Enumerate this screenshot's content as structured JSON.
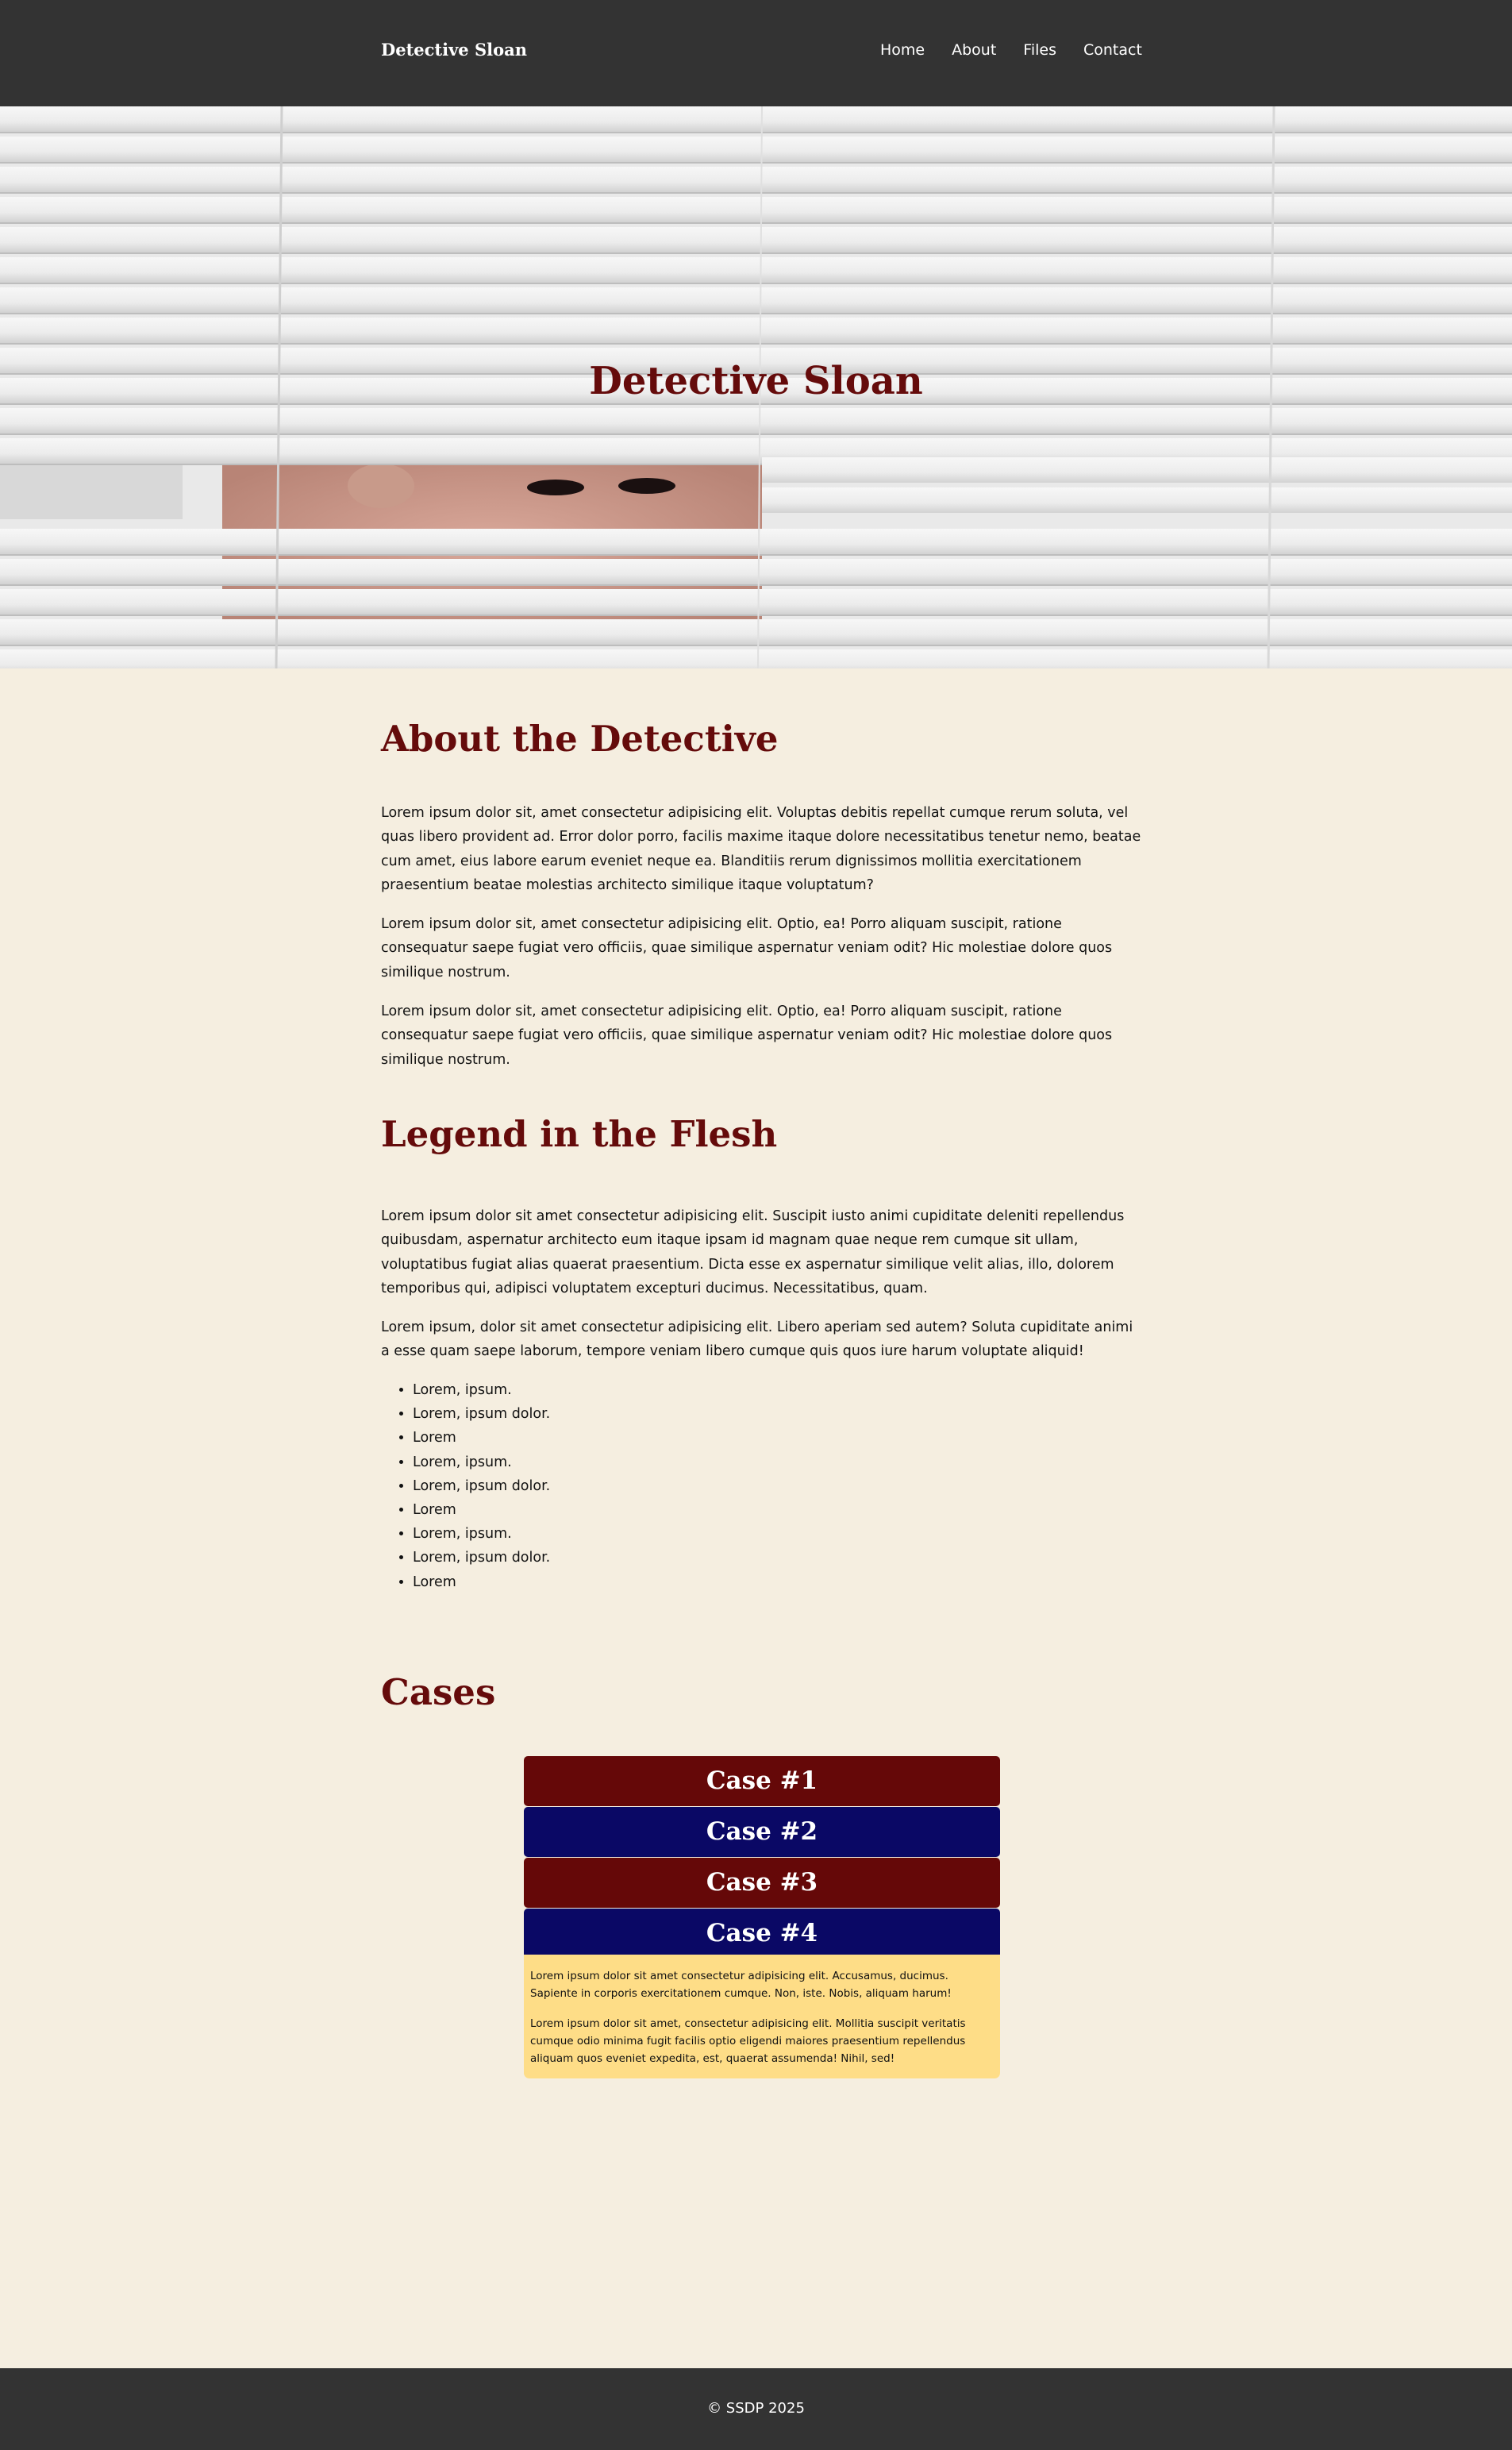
{
  "header": {
    "brand": "Detective Sloan",
    "nav": [
      "Home",
      "About",
      "Files",
      "Contact"
    ]
  },
  "hero": {
    "title": "Detective Sloan",
    "image_alt": "person-peeking-through-window-blinds"
  },
  "about": {
    "heading": "About the Detective",
    "paragraphs": [
      "Lorem ipsum dolor sit, amet consectetur adipisicing elit. Voluptas debitis repellat cumque rerum soluta, vel quas libero provident ad. Error dolor porro, facilis maxime itaque dolore necessitatibus tenetur nemo, beatae cum amet, eius labore earum eveniet neque ea. Blanditiis rerum dignissimos mollitia exercitationem praesentium beatae molestias architecto similique itaque voluptatum?",
      "Lorem ipsum dolor sit, amet consectetur adipisicing elit. Optio, ea! Porro aliquam suscipit, ratione consequatur saepe fugiat vero officiis, quae similique aspernatur veniam odit? Hic molestiae dolore quos similique nostrum.",
      "Lorem ipsum dolor sit, amet consectetur adipisicing elit. Optio, ea! Porro aliquam suscipit, ratione consequatur saepe fugiat vero officiis, quae similique aspernatur veniam odit? Hic molestiae dolore quos similique nostrum."
    ]
  },
  "legend": {
    "heading": "Legend in the Flesh",
    "paragraphs": [
      "Lorem ipsum dolor sit amet consectetur adipisicing elit. Suscipit iusto animi cupiditate deleniti repellendus quibusdam, aspernatur architecto eum itaque ipsam id magnam quae neque rem cumque sit ullam, voluptatibus fugiat alias quaerat praesentium. Dicta esse ex aspernatur similique velit alias, illo, dolorem temporibus qui, adipisci voluptatem excepturi ducimus. Necessitatibus, quam.",
      "Lorem ipsum, dolor sit amet consectetur adipisicing elit. Libero aperiam sed autem? Soluta cupiditate animi a esse quam saepe laborum, tempore veniam libero cumque quis quos iure harum voluptate aliquid!"
    ],
    "list": [
      "Lorem, ipsum.",
      "Lorem, ipsum dolor.",
      "Lorem",
      "Lorem, ipsum.",
      "Lorem, ipsum dolor.",
      "Lorem",
      "Lorem, ipsum.",
      "Lorem, ipsum dolor.",
      "Lorem"
    ]
  },
  "cases": {
    "heading": "Cases",
    "tabs": [
      "Case #1",
      "Case #2",
      "Case #3",
      "Case #4"
    ],
    "open_body": [
      "Lorem ipsum dolor sit amet consectetur adipisicing elit. Accusamus, ducimus. Sapiente in corporis exercitationem cumque. Non, iste. Nobis, aliquam harum!",
      "Lorem ipsum dolor sit amet, consectetur adipisicing elit. Mollitia suscipit veritatis cumque odio minima fugit facilis optio eligendi maiores praesentium repellendus aliquam quos eveniet expedita, est, quaerat assumenda! Nihil, sed!"
    ]
  },
  "footer": {
    "copyright": "© SSDP 2025"
  },
  "colors": {
    "header_bg": "#333333",
    "page_bg": "#f5eee0",
    "heading": "#650b0b",
    "case_red": "#650808",
    "case_blue": "#0a0865",
    "case_body_bg": "#fedd87"
  }
}
